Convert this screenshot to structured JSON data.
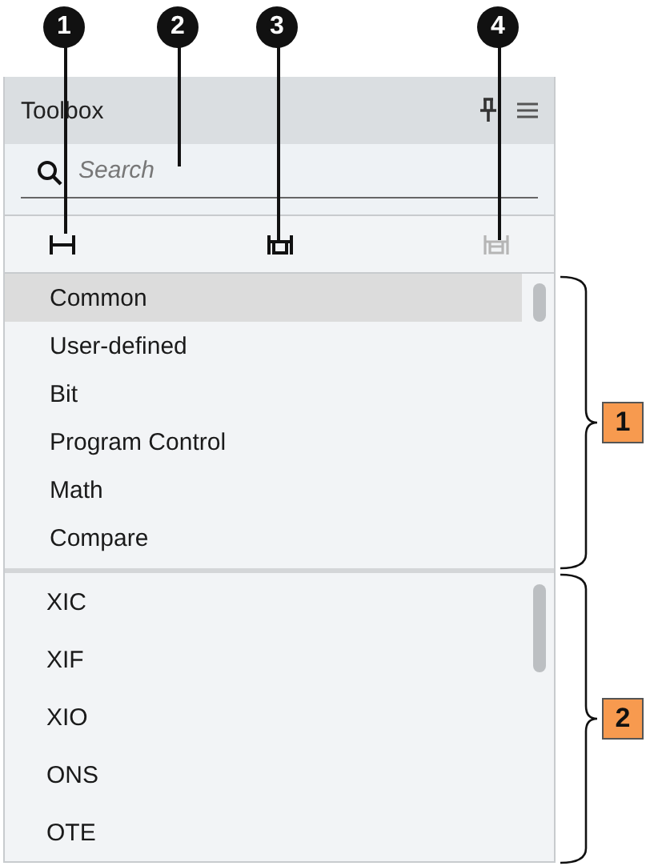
{
  "callouts": [
    {
      "label": "1"
    },
    {
      "label": "2"
    },
    {
      "label": "3"
    },
    {
      "label": "4"
    }
  ],
  "panel": {
    "title": "Toolbox",
    "search": {
      "placeholder": "Search"
    },
    "tools": [
      {
        "kind": "rung",
        "disabled": false
      },
      {
        "kind": "branch",
        "disabled": false
      },
      {
        "kind": "branch-level",
        "disabled": true
      }
    ],
    "categories": [
      {
        "label": "Common",
        "selected": true
      },
      {
        "label": "User-defined",
        "selected": false
      },
      {
        "label": "Bit",
        "selected": false
      },
      {
        "label": "Program Control",
        "selected": false
      },
      {
        "label": "Math",
        "selected": false
      },
      {
        "label": "Compare",
        "selected": false
      }
    ],
    "instructions": [
      {
        "label": "XIC"
      },
      {
        "label": "XIF"
      },
      {
        "label": "XIO"
      },
      {
        "label": "ONS"
      },
      {
        "label": "OTE"
      }
    ]
  },
  "brackets": [
    {
      "label": "1"
    },
    {
      "label": "2"
    }
  ]
}
